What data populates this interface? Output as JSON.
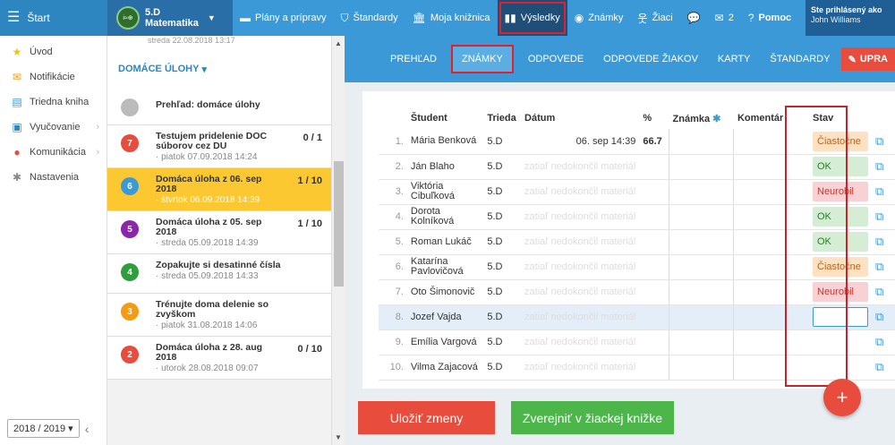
{
  "topbar": {
    "start": "Štart",
    "class_line1": "5.D",
    "class_line2": "Matematika",
    "logo_text": "i≈⊕",
    "items": [
      {
        "label": "Plány a prípravy"
      },
      {
        "label": "Štandardy"
      },
      {
        "label": "Moja knižnica"
      },
      {
        "label": "Výsledky",
        "active": true
      },
      {
        "label": "Známky"
      },
      {
        "label": "Žiaci"
      },
      {
        "label": ""
      },
      {
        "label": "2"
      },
      {
        "label": "Pomoc"
      }
    ],
    "user_line1": "Ste prihlásený ako",
    "user_line2": "John Williams"
  },
  "sidebar": {
    "items": [
      {
        "label": "Úvod",
        "icon": "star-icon"
      },
      {
        "label": "Notifikácie",
        "icon": "mail-icon"
      },
      {
        "label": "Triedna kniha",
        "icon": "book-icon"
      },
      {
        "label": "Vyučovanie",
        "icon": "board-icon"
      },
      {
        "label": "Komunikácia",
        "icon": "chat-icon"
      },
      {
        "label": "Nastavenia",
        "icon": "gear-icon"
      }
    ],
    "year": "2018 / 2019"
  },
  "tasks": {
    "top_fragment": "streda 22.08.2018 13:17",
    "section": "DOMÁCE ÚLOHY",
    "items": [
      {
        "num": "",
        "title": "Prehľad: domáce úlohy",
        "score": "",
        "date": "",
        "color": "#bbbbbb"
      },
      {
        "num": "7",
        "title": "Testujem pridelenie DOC súborov cez DU",
        "score": "0 / 1",
        "date": "· piatok 07.09.2018 14:24",
        "color": "#e74c3c"
      },
      {
        "num": "6",
        "title": "Domáca úloha z 06. sep 2018",
        "score": "1 / 10",
        "date": "· štvrtok 06.09.2018 14:39",
        "color": "#3b99d8"
      },
      {
        "num": "5",
        "title": "Domáca úloha z 05. sep 2018",
        "score": "1 / 10",
        "date": "· streda 05.09.2018 14:39",
        "color": "#8e24aa"
      },
      {
        "num": "4",
        "title": "Zopakujte si desatinné čísla",
        "score": "",
        "date": "· streda 05.09.2018 14:33",
        "color": "#2e9e3c"
      },
      {
        "num": "3",
        "title": "Trénujte doma delenie so zvyškom",
        "score": "",
        "date": "· piatok 31.08.2018 14:06",
        "color": "#f39c12"
      },
      {
        "num": "2",
        "title": "Domáca úloha z 28. aug 2018",
        "score": "0 / 10",
        "date": "· utorok 28.08.2018 09:07",
        "color": "#e74c3c"
      }
    ]
  },
  "subnav": {
    "tabs": [
      {
        "label": "PREHĽAD"
      },
      {
        "label": "ZNÁMKY",
        "active": true
      },
      {
        "label": "ODPOVEDE"
      },
      {
        "label": "ODPOVEDE ŽIAKOV"
      },
      {
        "label": "KARTY"
      },
      {
        "label": "ŠTANDARDY"
      }
    ],
    "edit": "UPRA"
  },
  "table": {
    "headers": {
      "student": "Študent",
      "trieda": "Trieda",
      "datum": "Dátum",
      "pct": "%",
      "znamka": "Známka",
      "komentar": "Komentár",
      "stav": "Stav"
    },
    "rows": [
      {
        "n": "1.",
        "name": "Mária Benková",
        "cls": "5.D",
        "date": "06. sep 14:39",
        "pct": "66.7",
        "stav": "Čiastočne",
        "kind": "part"
      },
      {
        "n": "2.",
        "name": "Ján Blaho",
        "cls": "5.D",
        "date": "zatiaľ nedokončil materiál",
        "pct": "",
        "stav": "OK",
        "kind": "ok"
      },
      {
        "n": "3.",
        "name": "Viktória Cibuľková",
        "cls": "5.D",
        "date": "zatiaľ nedokončil materiál",
        "pct": "",
        "stav": "Neurobil",
        "kind": "fail"
      },
      {
        "n": "4.",
        "name": "Dorota Kolníková",
        "cls": "5.D",
        "date": "zatiaľ nedokončil materiál",
        "pct": "",
        "stav": "OK",
        "kind": "ok"
      },
      {
        "n": "5.",
        "name": "Roman Lukáč",
        "cls": "5.D",
        "date": "zatiaľ nedokončil materiál",
        "pct": "",
        "stav": "OK",
        "kind": "ok"
      },
      {
        "n": "6.",
        "name": "Katarína Pavlovičová",
        "cls": "5.D",
        "date": "zatiaľ nedokončil materiál",
        "pct": "",
        "stav": "Čiastočne",
        "kind": "part"
      },
      {
        "n": "7.",
        "name": "Oto Šimonovič",
        "cls": "5.D",
        "date": "zatiaľ nedokončil materiál",
        "pct": "",
        "stav": "Neurobil",
        "kind": "fail"
      },
      {
        "n": "8.",
        "name": "Jozef Vajda",
        "cls": "5.D",
        "date": "zatiaľ nedokončil materiál",
        "pct": "",
        "stav": "",
        "kind": "empty"
      },
      {
        "n": "9.",
        "name": "Emília Vargová",
        "cls": "5.D",
        "date": "zatiaľ nedokončil materiál",
        "pct": "",
        "stav": "",
        "kind": "none"
      },
      {
        "n": "10.",
        "name": "Vilma Zajacová",
        "cls": "5.D",
        "date": "zatiaľ nedokončil materiál",
        "pct": "",
        "stav": "",
        "kind": "none"
      }
    ]
  },
  "buttons": {
    "save": "Uložiť zmeny",
    "publish": "Zverejniť v žiackej knižke",
    "fab": "+"
  },
  "colors": {
    "primary": "#3b99d8",
    "danger": "#e74c3c",
    "success": "#4cb64a",
    "highlight": "#fcc831"
  }
}
